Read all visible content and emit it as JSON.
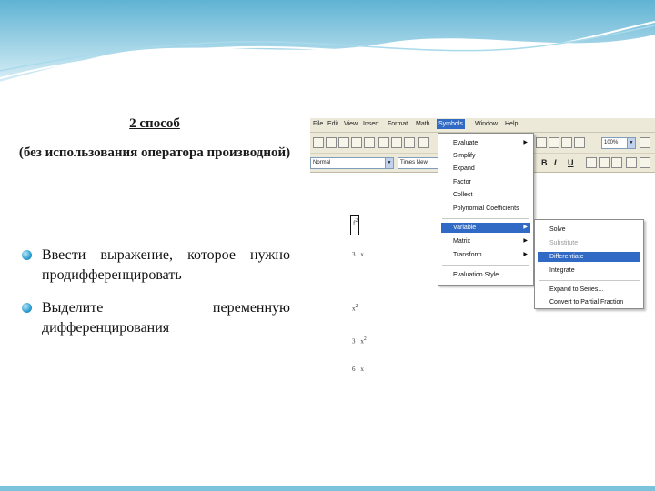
{
  "slide": {
    "heading": "2 способ ",
    "subheading": "(без использования оператора производной)",
    "bullets": [
      "Ввести выражение, которое нужно продифференцировать",
      "Выделите переменную дифференцирования"
    ]
  },
  "app": {
    "menubar": [
      "File",
      "Edit",
      "View",
      "Insert",
      "Format",
      "Math",
      "Symbols",
      "Window",
      "Help"
    ],
    "active_menu": "Symbols",
    "zoom": "100%",
    "style_combo": "Normal",
    "font_combo": "Times New Roman",
    "format_buttons": [
      "B",
      "I",
      "U"
    ],
    "document": {
      "line1": "f",
      "line1_sup": "2",
      "line2": "3 · x",
      "line3": "x",
      "line3_sup": "2",
      "line4": "3 · x",
      "line4_sup": "2",
      "line5": "6 · x"
    },
    "symbols_menu": [
      {
        "label": "Evaluate",
        "submenu": true
      },
      {
        "label": "Simplify"
      },
      {
        "label": "Expand"
      },
      {
        "label": "Factor"
      },
      {
        "label": "Collect"
      },
      {
        "label": "Polynomial Coefficients"
      },
      {
        "label": "Variable",
        "submenu": true,
        "selected": true
      },
      {
        "label": "Matrix",
        "submenu": true
      },
      {
        "label": "Transform",
        "submenu": true
      },
      {
        "label": "Evaluation Style..."
      }
    ],
    "variable_submenu": [
      {
        "label": "Solve"
      },
      {
        "label": "Substitute",
        "disabled": true
      },
      {
        "label": "Differentiate",
        "selected": true
      },
      {
        "label": "Integrate"
      },
      {
        "label": "Expand to Series..."
      },
      {
        "label": "Convert to Partial Fraction"
      }
    ]
  },
  "colors": {
    "accent": "#316ac5",
    "bullet": "#2c9fd1",
    "wave": "#7bc2da"
  }
}
